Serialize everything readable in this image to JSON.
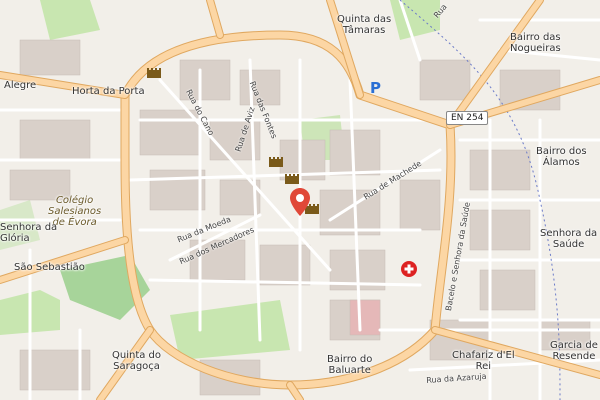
{
  "map": {
    "places": [
      {
        "key": "quinta-das-tamaras",
        "text": "Quinta das\nTâmaras"
      },
      {
        "key": "bairro-das-nogueiras",
        "text": "Bairro das\nNogueiras"
      },
      {
        "key": "alegre",
        "text": "Alegre"
      },
      {
        "key": "horta-da-porta",
        "text": "Horta da Porta"
      },
      {
        "key": "bairro-dos-alamos",
        "text": "Bairro dos\nÁlamos"
      },
      {
        "key": "colegio-salesianos",
        "text": "Colégio\nSalesianos\nde Évora"
      },
      {
        "key": "senhora-left",
        "text": "Senhora da\nGlória"
      },
      {
        "key": "sao-sebastiao",
        "text": "São Sebastião"
      },
      {
        "key": "senhora-saude",
        "text": "Senhora da\nSaúde"
      },
      {
        "key": "quinta-do-saragoca",
        "text": "Quinta do\nSaragoça"
      },
      {
        "key": "bairro-do-baluarte",
        "text": "Bairro do\nBaluarte"
      },
      {
        "key": "chafariz-del-rei",
        "text": "Chafariz d'El\nRei"
      },
      {
        "key": "garcia-de-resende",
        "text": "Garcia de\nResende"
      }
    ],
    "streets": [
      {
        "key": "rua-do-cano",
        "text": "Rua do Cano"
      },
      {
        "key": "rua-das-fontes",
        "text": "Rua das Fontes"
      },
      {
        "key": "rua-de-aviz",
        "text": "Rua de Aviz"
      },
      {
        "key": "rua-de-machede",
        "text": "Rua de Machede"
      },
      {
        "key": "rua-da-moeda",
        "text": "Rua da Moeda"
      },
      {
        "key": "rua-dos-mercadores",
        "text": "Rua dos Mercadores"
      },
      {
        "key": "bacelo-senhora-saude",
        "text": "Bacelo e Senhora da Saúde"
      },
      {
        "key": "rua-da-azaruja",
        "text": "Rua da Azaruja"
      },
      {
        "key": "rua-top",
        "text": "Rua"
      }
    ],
    "road_shield": "EN 254",
    "parking_symbol": "P",
    "colors": {
      "background": "#f2efe9",
      "major_road": "#fcd6a4",
      "major_road_casing": "#e0a860",
      "minor_road": "#ffffff",
      "building": "#d9d0c9",
      "park": "#c8e6b0",
      "marker": "#e04838",
      "hospital": "#d22"
    }
  }
}
